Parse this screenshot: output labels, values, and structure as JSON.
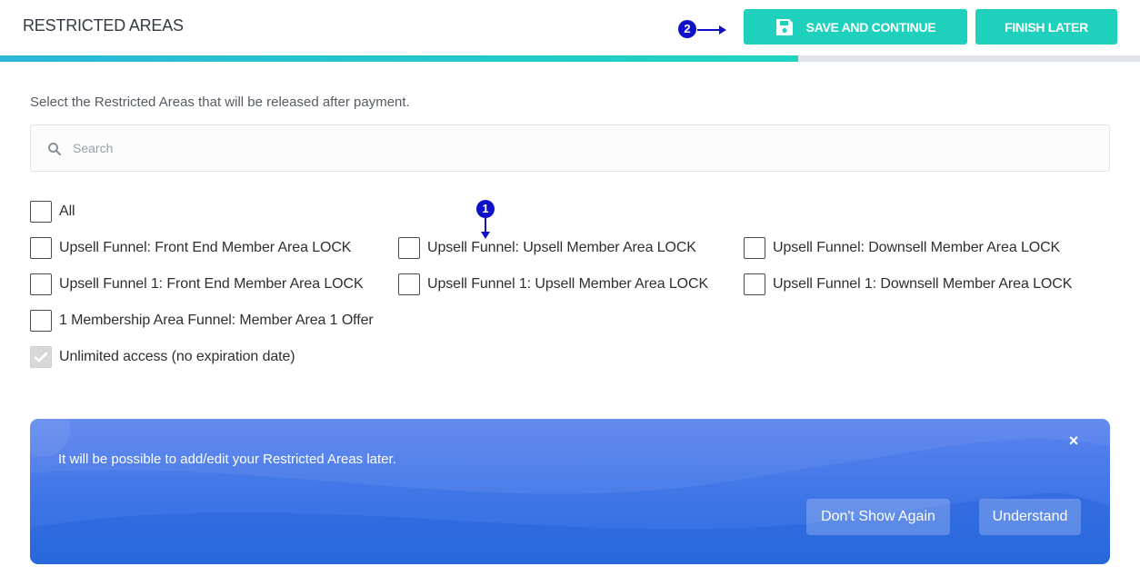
{
  "header": {
    "title": "RESTRICTED AREAS",
    "save_label": "SAVE AND CONTINUE",
    "finish_label": "FINISH LATER",
    "progress_percent": 70
  },
  "annotations": {
    "marker_1": "1",
    "marker_2": "2"
  },
  "instruction": "Select the Restricted Areas that will be released after payment.",
  "search": {
    "value": "",
    "placeholder": "Search"
  },
  "options": {
    "all": "All",
    "items": [
      "Upsell Funnel: Front End Member Area LOCK",
      "Upsell Funnel: Upsell Member Area LOCK",
      "Upsell Funnel: Downsell Member Area LOCK",
      "Upsell Funnel 1: Front End Member Area LOCK",
      "Upsell Funnel 1: Upsell Member Area LOCK",
      "Upsell Funnel 1: Downsell Member Area LOCK",
      "1 Membership Area Funnel: Member Area 1 Offer"
    ],
    "unlimited": "Unlimited access (no expiration date)"
  },
  "notice": {
    "text": "It will be possible to add/edit your Restricted Areas later.",
    "close_glyph": "×",
    "dont_show_label": "Don't Show Again",
    "understand_label": "Understand"
  },
  "colors": {
    "accent_teal": "#1fd1bd",
    "notice_blue": "#3f75e6",
    "annotation_blue": "#1010c8"
  },
  "icons": [
    "save-icon",
    "search-icon",
    "check-icon",
    "close-icon"
  ]
}
